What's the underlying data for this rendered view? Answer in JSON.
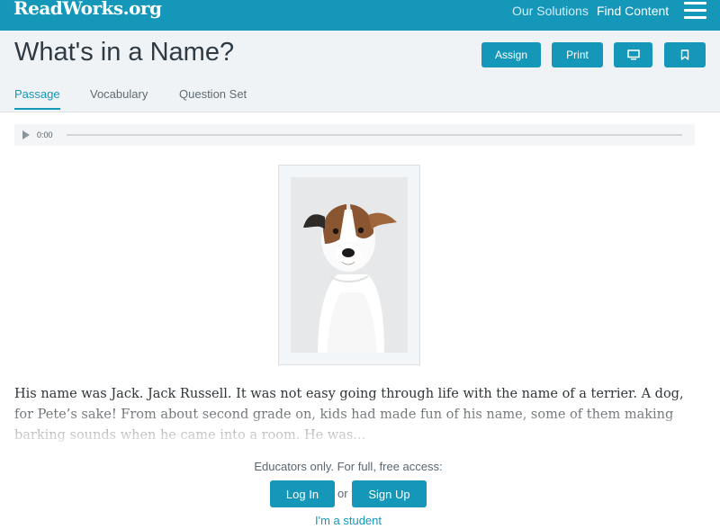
{
  "header": {
    "logo": "ReadWorks.org",
    "nav": {
      "solutions": "Our Solutions",
      "find_content": "Find Content"
    },
    "menu_icon": "hamburger-menu-icon",
    "bg_color": "#1597b9"
  },
  "title_bar": {
    "title": "What's in a Name?",
    "buttons": {
      "assign": "Assign",
      "print": "Print",
      "present_icon": "monitor-icon",
      "bookmark_icon": "bookmark-icon"
    },
    "tabs": [
      "Passage",
      "Vocabulary",
      "Question Set"
    ],
    "active_tab": "Passage"
  },
  "audio": {
    "time": "0:00",
    "play_icon": "play-icon"
  },
  "passage": {
    "image": "jack-russell-terrier-photo",
    "text": "His name was Jack. Jack Russell. It was not easy going through life with the name of a terrier. A dog, for Pete’s sake!  From about second grade on, kids had made fun of his name, some of them making barking sounds when he came into a room. He was..."
  },
  "cta": {
    "message": "Educators only. For full, free access:",
    "login": "Log In",
    "or": "or",
    "signup": "Sign Up",
    "student": "I'm a student"
  },
  "accent_color": "#1597b9"
}
